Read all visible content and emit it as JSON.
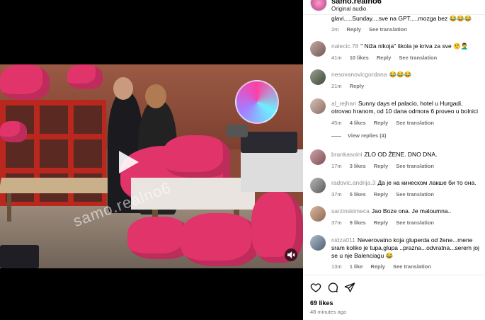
{
  "header": {
    "username": "samo.realno6",
    "audio": "Original audio"
  },
  "video": {
    "watermark": "samo.realno6"
  },
  "comments": [
    {
      "username": "",
      "text": "glavi.....Sunday....sve na GPT.....mozga bez 😂😂😂",
      "time": "2m",
      "likes": "",
      "reply": "Reply",
      "translate": "See translation"
    },
    {
      "username": "nalecic.78",
      "text": "\" Niža nikoja\" škola je kriva za sve 🤨🤦‍♂️",
      "time": "41m",
      "likes": "10 likes",
      "reply": "Reply",
      "translate": "See translation"
    },
    {
      "username": "nesovanovicgordana",
      "text": "😂😂😂",
      "time": "21m",
      "likes": "",
      "reply": "Reply",
      "translate": ""
    },
    {
      "username": "al_rejhan",
      "text": "Sunny days el palacio, hotel u Hurgadi, otrovao hranom, od 10 dana odmora 6 proveo u bolnici😂😂😂😂",
      "time": "45m",
      "likes": "4 likes",
      "reply": "Reply",
      "translate": "See translation",
      "view_replies": "View replies (4)"
    },
    {
      "username": "brankasoini",
      "text": "ZLO OD ŽENE. DNO DNA.",
      "time": "17m",
      "likes": "3 likes",
      "reply": "Reply",
      "translate": "See translation"
    },
    {
      "username": "radovic.andrija.3",
      "text": "Да је на кинеском лакше би то она.",
      "time": "37m",
      "likes": "5 likes",
      "reply": "Reply",
      "translate": "See translation"
    },
    {
      "username": "sarzinskimeca",
      "text": "Jao Boze ona. Je maloumna..",
      "time": "37m",
      "likes": "9 likes",
      "reply": "Reply",
      "translate": "See translation"
    },
    {
      "username": "nidza011",
      "text": "Neverovatno koja gluperda od žene...mene sram koliko je tupa,glupa ..prazna...odvratna...serem joj se u nje Balenciagu 😂",
      "time": "13m",
      "likes": "1 like",
      "reply": "Reply",
      "translate": "See translation"
    }
  ],
  "actions": {
    "like_icon": "heart-outline-icon",
    "comment_icon": "comment-bubble-icon",
    "share_icon": "paper-plane-icon"
  },
  "footer": {
    "likes": "69 likes",
    "time": "48 minutes ago"
  },
  "colors": {
    "bag_pink": "#e0346b",
    "shelf_red": "#b9271f",
    "meta_gray": "#737373"
  }
}
